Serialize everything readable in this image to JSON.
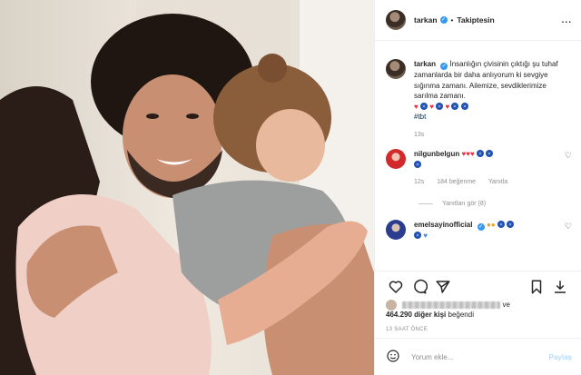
{
  "post": {
    "author": "tarkan",
    "follow_label": "Takiptesin",
    "more": "...",
    "caption": "İnsanlığın çivisinin çıktığı şu tuhaf zamanlarda bir daha anlıyorum ki sevgiye sığınma zamanı. Ailemize, sevdiklerimize sarılma zamanı.",
    "hashtag": "#tbt",
    "caption_time": "13s",
    "image_alt": "family-hug-photo"
  },
  "comments": [
    {
      "username": "nilgunbelgun",
      "time": "12s",
      "likes": "184 beğenme",
      "reply": "Yanıtla",
      "view_replies": "Yanıtları gör (8)"
    },
    {
      "username": "emelsayinofficial"
    }
  ],
  "likes": {
    "and": "ve",
    "count": "464.290 diğer kişi",
    "suffix": "beğendi"
  },
  "timestamp": "13 SAAT ÖNCE",
  "comment_input": {
    "placeholder": "Yorum ekle..."
  },
  "post_button": "Paylaş",
  "colors": {
    "verified": "#3897f0",
    "link": "#00376b",
    "post_disabled": "#b3dbff"
  }
}
